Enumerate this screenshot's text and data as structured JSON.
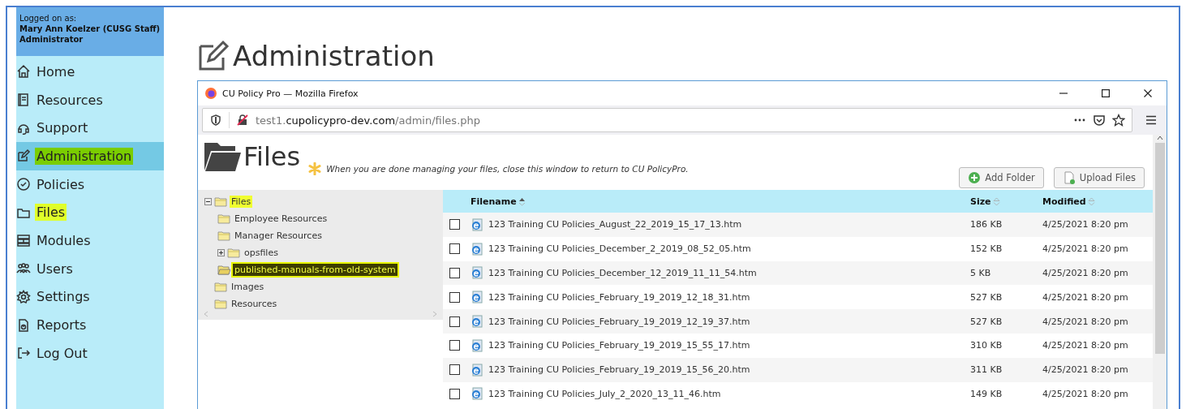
{
  "sidebar": {
    "login_label": "Logged on as:",
    "user": "Mary Ann Koelzer (CUSG Staff)",
    "role": "Administrator",
    "items": [
      {
        "label": "Home",
        "selected": false,
        "highlighted": false
      },
      {
        "label": "Resources",
        "selected": false,
        "highlighted": false
      },
      {
        "label": "Support",
        "selected": false,
        "highlighted": false
      },
      {
        "label": "Administration",
        "selected": true,
        "highlighted": true
      },
      {
        "label": "Policies",
        "selected": false,
        "highlighted": false
      },
      {
        "label": "Files",
        "selected": false,
        "highlighted": true
      },
      {
        "label": "Modules",
        "selected": false,
        "highlighted": false
      },
      {
        "label": "Users",
        "selected": false,
        "highlighted": false
      },
      {
        "label": "Settings",
        "selected": false,
        "highlighted": false
      },
      {
        "label": "Reports",
        "selected": false,
        "highlighted": false
      },
      {
        "label": "Log Out",
        "selected": false,
        "highlighted": false
      }
    ]
  },
  "page_title": "Administration",
  "browser": {
    "title": "CU Policy Pro — Mozilla Firefox",
    "url_host": "test1.",
    "url_domain": "cupolicypro-dev.com",
    "url_path": "/admin/files.php"
  },
  "files_panel": {
    "title": "Files",
    "notice": "When you are done managing your files, close this window to return to CU PolicyPro.",
    "buttons": [
      {
        "label": "Add Folder",
        "kind": "add"
      },
      {
        "label": "Upload Files",
        "kind": "upload"
      }
    ],
    "tree": [
      {
        "label": "Files",
        "expanded": true,
        "selected": false,
        "highlighted": true,
        "children": [
          {
            "label": "Employee Resources",
            "selected": false,
            "highlighted": false
          },
          {
            "label": "Manager Resources",
            "selected": false,
            "highlighted": false
          },
          {
            "label": "opsfiles",
            "expanded": false,
            "selected": false,
            "highlighted": false
          },
          {
            "label": "published-manuals-from-old-system",
            "selected": true,
            "highlighted": true
          }
        ]
      },
      {
        "label": "Images",
        "selected": false,
        "highlighted": false
      },
      {
        "label": "Resources",
        "selected": false,
        "highlighted": false
      }
    ],
    "table": {
      "columns": [
        {
          "label": "Filename",
          "sorted": true
        },
        {
          "label": "Size",
          "sorted": false
        },
        {
          "label": "Modified",
          "sorted": false
        }
      ],
      "rows": [
        {
          "checked": false,
          "filename": "123 Training CU Policies_August_22_2019_15_17_13.htm",
          "size": "186 KB",
          "modified": "4/25/2021 8:20 pm"
        },
        {
          "checked": false,
          "filename": "123 Training CU Policies_December_2_2019_08_52_05.htm",
          "size": "152 KB",
          "modified": "4/25/2021 8:20 pm"
        },
        {
          "checked": false,
          "filename": "123 Training CU Policies_December_12_2019_11_11_54.htm",
          "size": "5 KB",
          "modified": "4/25/2021 8:20 pm"
        },
        {
          "checked": false,
          "filename": "123 Training CU Policies_February_19_2019_12_18_31.htm",
          "size": "527 KB",
          "modified": "4/25/2021 8:20 pm"
        },
        {
          "checked": false,
          "filename": "123 Training CU Policies_February_19_2019_12_19_37.htm",
          "size": "527 KB",
          "modified": "4/25/2021 8:20 pm"
        },
        {
          "checked": false,
          "filename": "123 Training CU Policies_February_19_2019_15_55_17.htm",
          "size": "310 KB",
          "modified": "4/25/2021 8:20 pm"
        },
        {
          "checked": false,
          "filename": "123 Training CU Policies_February_19_2019_15_56_20.htm",
          "size": "311 KB",
          "modified": "4/25/2021 8:20 pm"
        },
        {
          "checked": false,
          "filename": "123 Training CU Policies_July_2_2020_13_11_46.htm",
          "size": "149 KB",
          "modified": "4/25/2021 8:20 pm"
        }
      ]
    }
  }
}
